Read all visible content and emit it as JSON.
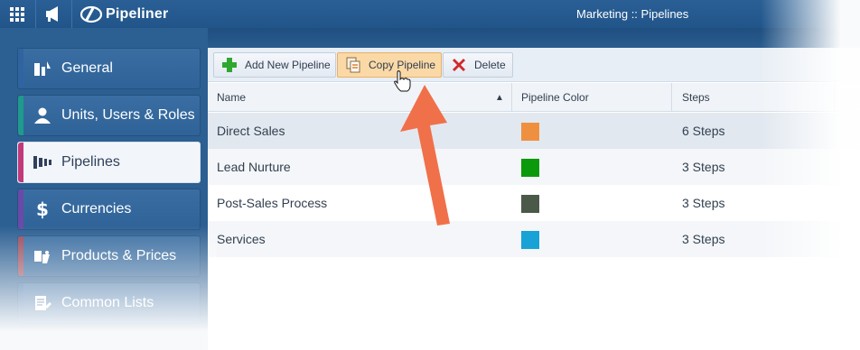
{
  "topbar": {
    "app_name": "Pipeliner",
    "breadcrumb": "Marketing :: Pipelines"
  },
  "sidebar": {
    "items": [
      {
        "label": "General",
        "icon": "building-chart-icon",
        "accent": "#2f64a0"
      },
      {
        "label": "Units, Users & Roles",
        "icon": "user-icon",
        "accent": "#1f9a8c"
      },
      {
        "label": "Pipelines",
        "icon": "pipeline-funnel-icon",
        "accent": "#c0397a"
      },
      {
        "label": "Currencies",
        "icon": "dollar-icon",
        "accent": "#6a4aa8"
      },
      {
        "label": "Products & Prices",
        "icon": "product-tag-icon",
        "accent": "#9b4a5c"
      },
      {
        "label": "Common Lists",
        "icon": "list-edit-icon",
        "accent": "#2f64a0"
      }
    ],
    "active_index": 2
  },
  "toolbar": {
    "add_label": "Add New Pipeline",
    "copy_label": "Copy Pipeline",
    "delete_label": "Delete"
  },
  "table": {
    "columns": [
      "Name",
      "Pipeline Color",
      "Steps"
    ],
    "sort_indicator": "▲",
    "rows": [
      {
        "name": "Direct Sales",
        "color": "#ef9040",
        "steps": "6 Steps"
      },
      {
        "name": "Lead Nurture",
        "color": "#0b9a0b",
        "steps": "3 Steps"
      },
      {
        "name": "Post-Sales Process",
        "color": "#4b5a48",
        "steps": "3 Steps"
      },
      {
        "name": "Services",
        "color": "#18a2d6",
        "steps": "3 Steps"
      }
    ]
  },
  "colors": {
    "topbar": "#2a5f95",
    "hover_button": "#fbd9a6",
    "arrow": "#f0704a"
  }
}
